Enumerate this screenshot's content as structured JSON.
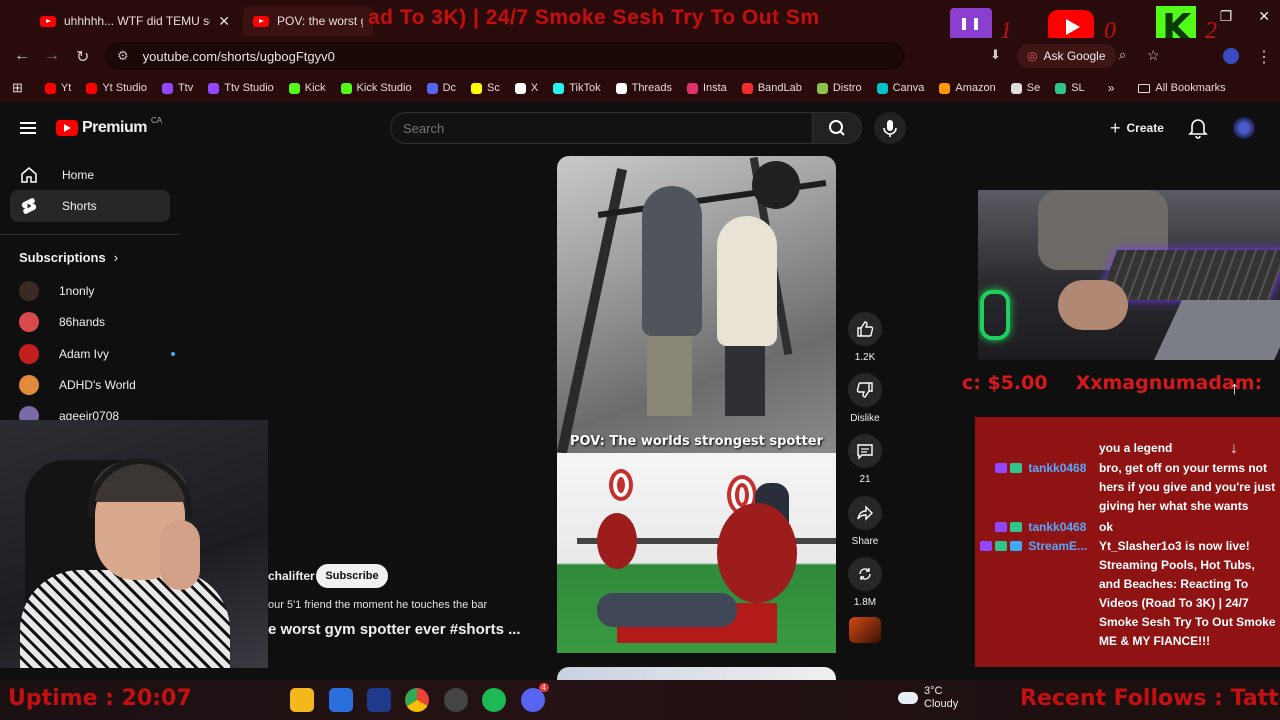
{
  "browser": {
    "tabs": [
      {
        "title": "uhhhhh... WTF did TEMU sell m"
      },
      {
        "title": "POV: the worst gym s"
      }
    ],
    "url": "youtube.com/shorts/ugbogFtgyv0",
    "ask_google": "Ask Google",
    "bookmarks": [
      {
        "label": "Yt",
        "color": "#ff0000"
      },
      {
        "label": "Yt Studio",
        "color": "#ff0000"
      },
      {
        "label": "Ttv",
        "color": "#9146ff"
      },
      {
        "label": "Ttv Studio",
        "color": "#9146ff"
      },
      {
        "label": "Kick",
        "color": "#53fc18"
      },
      {
        "label": "Kick Studio",
        "color": "#53fc18"
      },
      {
        "label": "Dc",
        "color": "#5865f2"
      },
      {
        "label": "Sc",
        "color": "#fffc00"
      },
      {
        "label": "X",
        "color": "#ffffff"
      },
      {
        "label": "TikTok",
        "color": "#25f4ee"
      },
      {
        "label": "Threads",
        "color": "#ffffff"
      },
      {
        "label": "Insta",
        "color": "#e1306c"
      },
      {
        "label": "BandLab",
        "color": "#f12c2c"
      },
      {
        "label": "Distro",
        "color": "#8bc34a"
      },
      {
        "label": "Canva",
        "color": "#00c4cc"
      },
      {
        "label": "Amazon",
        "color": "#ff9900"
      },
      {
        "label": "Se",
        "color": "#dddddd"
      },
      {
        "label": "SL",
        "color": "#31c48d"
      }
    ],
    "all_bookmarks": "All Bookmarks"
  },
  "stream_overlay": {
    "title_marquee": "ad To 3K) | 24/7 Smoke Sesh Try To Out Sm",
    "twitch_count": "1",
    "youtube_count": "0",
    "kick_count": "2",
    "donation_amount": "c: $5.00",
    "donation_name": "Xxmagnumadam:",
    "uptime": "Uptime : 20:07",
    "recent_follows": "Recent Follows : TattedT"
  },
  "youtube": {
    "brand": "Premium",
    "region": "CA",
    "search_placeholder": "Search",
    "create_label": "Create",
    "sidebar": {
      "home": "Home",
      "shorts": "Shorts",
      "subscriptions_heading": "Subscriptions",
      "subscriptions": [
        {
          "name": "1nonly",
          "color": "#3b2a22"
        },
        {
          "name": "86hands",
          "color": "#d84b4b"
        },
        {
          "name": "Adam Ivy",
          "color": "#c41e1e"
        },
        {
          "name": "ADHD's World",
          "color": "#e08a3a"
        },
        {
          "name": "ageeir0708",
          "color": "#7a6aa8"
        }
      ]
    },
    "short": {
      "caption": "POV: The worlds strongest spotter",
      "channel": "chalifter",
      "subscribe_label": "Subscribe",
      "description": "our 5'1 friend the moment he touches the bar",
      "title": "e worst gym spotter ever #shorts ..."
    },
    "actions": {
      "like_count": "1.2K",
      "dislike_label": "Dislike",
      "comments_count": "21",
      "share_label": "Share",
      "remix_count": "1.8M"
    }
  },
  "chat": {
    "messages": [
      {
        "badges": [],
        "user": "",
        "text": "you a legend"
      },
      {
        "badges": [
          "#9146ff",
          "#31c48d"
        ],
        "user": "tankk0468",
        "text": "bro, get off on your terms not hers if you give and you're just giving her what she wants"
      },
      {
        "badges": [
          "#9146ff",
          "#31c48d"
        ],
        "user": "tankk0468",
        "text": "ok"
      },
      {
        "badges": [
          "#9146ff",
          "#31c48d",
          "#3fa9f5"
        ],
        "user": "StreamE...",
        "text": "Yt_Slasher1o3 is now live! Streaming Pools, Hot Tubs, and Beaches: Reacting To Videos (Road To 3K) | 24/7 Smoke Sesh Try To Out Smoke ME & MY FIANCE!!!"
      }
    ]
  },
  "taskbar": {
    "temperature": "3°C",
    "condition": "Cloudy",
    "discord_badge": "4"
  }
}
